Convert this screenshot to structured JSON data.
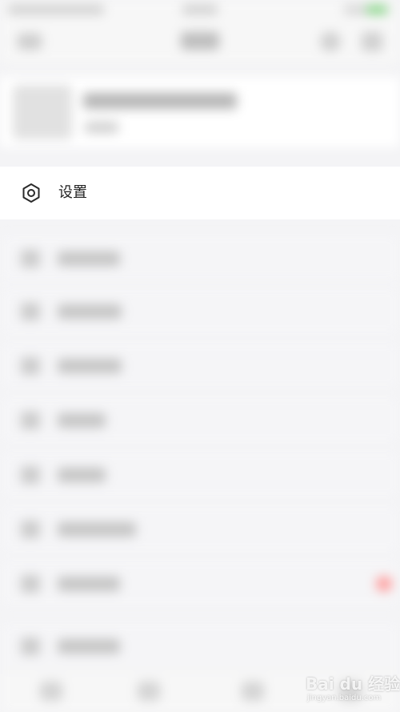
{
  "settings_row": {
    "label": "设置",
    "icon": "gear-icon"
  },
  "watermark": {
    "text": "Bai du 经验",
    "sub": "jingyan.baidu.com"
  },
  "colors": {
    "background": "#f4f4f6",
    "row_background": "#ffffff",
    "label_color": "#222222",
    "badge_red": "#ff9a9a"
  }
}
